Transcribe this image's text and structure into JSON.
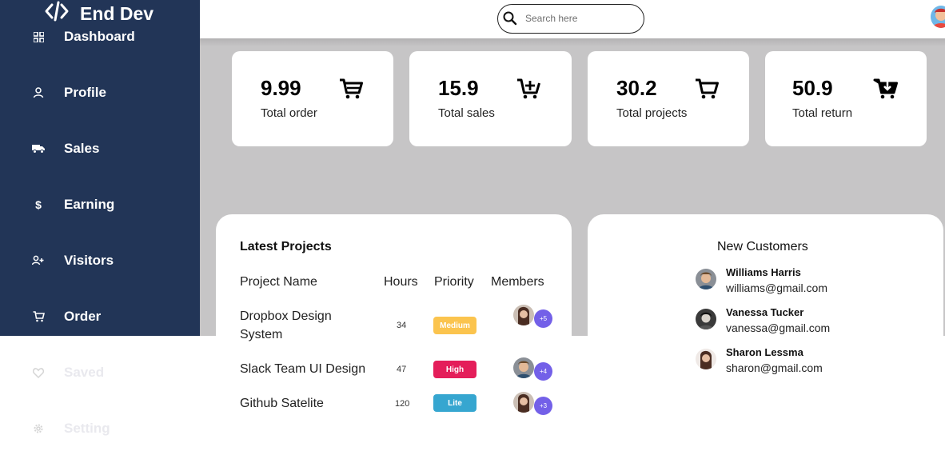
{
  "brand": {
    "name": "End Dev"
  },
  "sidebar": {
    "items": [
      {
        "label": "Dashboard",
        "icon": "grid-icon"
      },
      {
        "label": "Profile",
        "icon": "user-icon"
      },
      {
        "label": "Sales",
        "icon": "truck-icon"
      },
      {
        "label": "Earning",
        "icon": "dollar-icon"
      },
      {
        "label": "Visitors",
        "icon": "user-add-icon"
      },
      {
        "label": "Order",
        "icon": "cart-icon"
      },
      {
        "label": "Saved",
        "icon": "heart-icon"
      },
      {
        "label": "Setting",
        "icon": "gear-icon"
      }
    ]
  },
  "search": {
    "placeholder": "Search here"
  },
  "cards": [
    {
      "value": "9.99",
      "caption": "Total order",
      "icon": "cart-icon"
    },
    {
      "value": "15.9",
      "caption": "Total sales",
      "icon": "cart-plus-icon"
    },
    {
      "value": "30.2",
      "caption": "Total projects",
      "icon": "cart-icon"
    },
    {
      "value": "50.9",
      "caption": "Total return",
      "icon": "cart-download-icon"
    }
  ],
  "projects": {
    "title": "Latest Projects",
    "headers": {
      "name": "Project Name",
      "hours": "Hours",
      "priority": "Priority",
      "members": "Members"
    },
    "rows": [
      {
        "name": "Dropbox Design System",
        "hours": "34",
        "priority": "Medium",
        "priority_color": "#fbc44e",
        "extra": "+5"
      },
      {
        "name": "Slack Team UI Design",
        "hours": "47",
        "priority": "High",
        "priority_color": "#e41e5a",
        "extra": "+4"
      },
      {
        "name": "Github Satelite",
        "hours": "120",
        "priority": "Lite",
        "priority_color": "#36a6d0",
        "extra": "+3"
      }
    ]
  },
  "customers": {
    "title": "New Customers",
    "list": [
      {
        "name": "Williams Harris",
        "email": "williams@gmail.com"
      },
      {
        "name": "Vanessa Tucker",
        "email": "vanessa@gmail.com"
      },
      {
        "name": "Sharon Lessma",
        "email": "sharon@gmail.com"
      }
    ]
  },
  "colors": {
    "sidebar": "#223557",
    "background": "#c6c5c6",
    "accent": "#7360e8"
  }
}
